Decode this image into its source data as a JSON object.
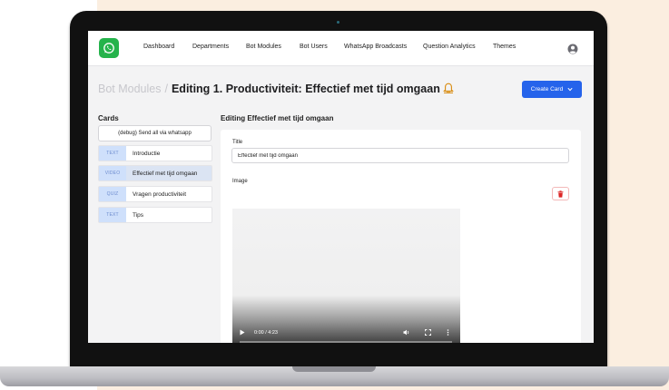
{
  "navbar": {
    "items": [
      "Dashboard",
      "Departments",
      "Bot Modules",
      "Bot Users",
      "WhatsApp Broadcasts",
      "Question Analytics",
      "Themes"
    ]
  },
  "breadcrumb": {
    "parent": "Bot Modules",
    "separator": "/",
    "title": "Editing 1. Productiviteit: Effectief met tijd omgaan"
  },
  "create_button": {
    "label": "Create Card"
  },
  "cards": {
    "heading": "Cards",
    "debug_label": "(debug) Send all via whatsapp",
    "items": [
      {
        "type": "TEXT",
        "label": "Introductie",
        "active": false
      },
      {
        "type": "VIDEO",
        "label": "Effectief met tijd omgaan",
        "active": true
      },
      {
        "type": "QUIZ",
        "label": "Vragen productiviteit",
        "active": false
      },
      {
        "type": "TEXT",
        "label": "Tips",
        "active": false
      }
    ]
  },
  "editor": {
    "heading": "Editing Effectief met tijd omgaan",
    "title_label": "Title",
    "title_value": "Effectief met tijd omgaan",
    "image_label": "Image"
  },
  "video": {
    "time": "0:00 / 4:23",
    "progress": 0
  },
  "colors": {
    "brand": "#25b34b",
    "accent": "#2563eb",
    "danger": "#dc2626",
    "background_peach": "#fbeee0"
  },
  "icons": [
    "whatsapp-logo-icon",
    "user-circle-icon",
    "bell-icon",
    "chevron-down-icon",
    "trash-icon",
    "play-icon",
    "volume-icon",
    "fullscreen-icon",
    "more-vertical-icon"
  ]
}
